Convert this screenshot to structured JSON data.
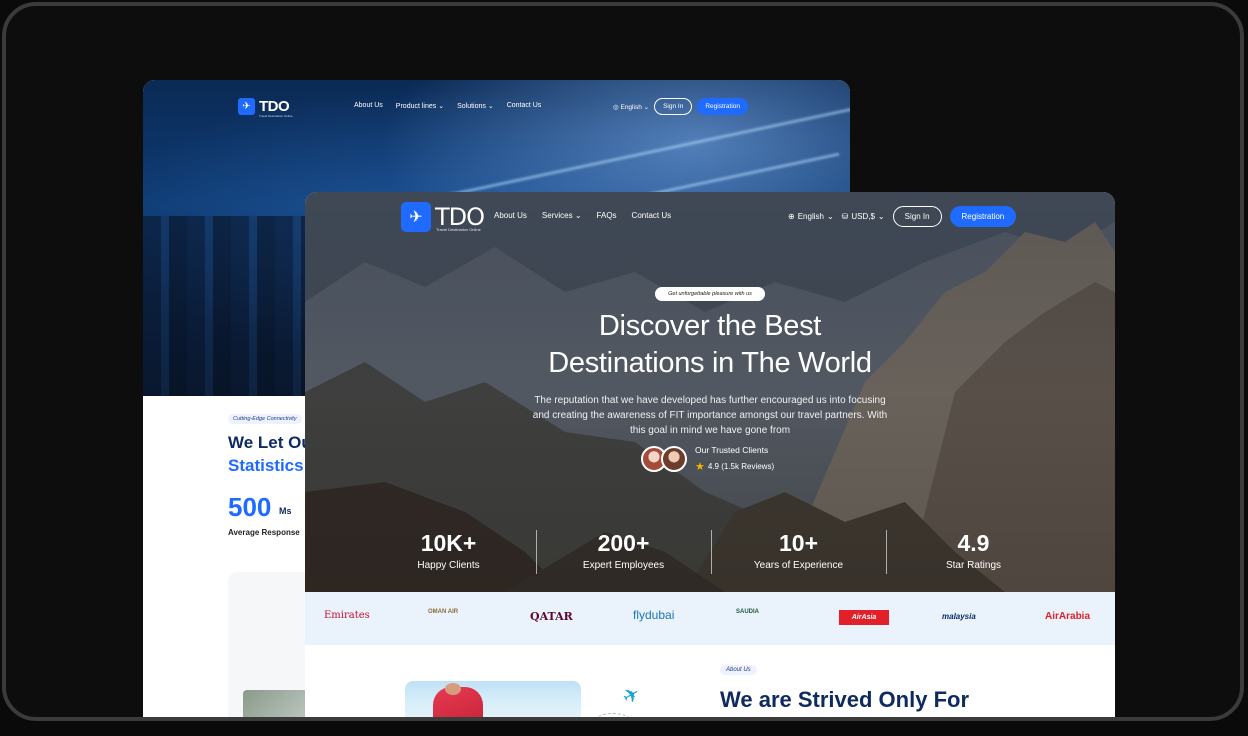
{
  "back": {
    "nav": {
      "logo": "TDO",
      "logo_tag": "Travel Destination Online",
      "menu": [
        "About Us",
        "Product lines",
        "Solutions",
        "Contact Us"
      ],
      "language": "English",
      "sign_in": "Sign In",
      "register": "Registration"
    },
    "pill": "Cutting-Edge Connectivity",
    "heading_1": "We Let Ou",
    "heading_2": "Statistics",
    "stat_value": "500",
    "stat_unit": "Ms",
    "stat_label": "Average Response"
  },
  "front": {
    "nav": {
      "logo": "TDO",
      "logo_tag": "Travel Destination Online",
      "menu": [
        "About Us",
        "Services",
        "FAQs",
        "Contact Us"
      ],
      "language": "English",
      "currency": "USD,$",
      "sign_in": "Sign In",
      "register": "Registration"
    },
    "hero": {
      "tagline": "Get unforgettable pleasure with us",
      "title_line_1": "Discover the Best",
      "title_line_2": "Destinations in The World",
      "description": "The reputation that we have developed has further encouraged us into focusing and creating the awareness of FIT importance amongst our travel partners. With this goal in mind we have gone from",
      "trusted_label": "Our Trusted Clients",
      "rating_text": "4.9 (1.5k Reviews)"
    },
    "stats": [
      {
        "value": "10K+",
        "label": "Happy Clients"
      },
      {
        "value": "200+",
        "label": "Expert Employees"
      },
      {
        "value": "10+",
        "label": "Years of Experience"
      },
      {
        "value": "4.9",
        "label": "Star Ratings"
      }
    ],
    "airlines": [
      "Emirates",
      "OMAN AIR",
      "QATAR",
      "flydubai",
      "SAUDIA",
      "AirAsia",
      "malaysia",
      "AirArabia"
    ],
    "about": {
      "pill": "About Us",
      "title": "We are Strived Only For"
    }
  },
  "colors": {
    "accent": "#1f6bff",
    "navy": "#0f2a5f"
  }
}
